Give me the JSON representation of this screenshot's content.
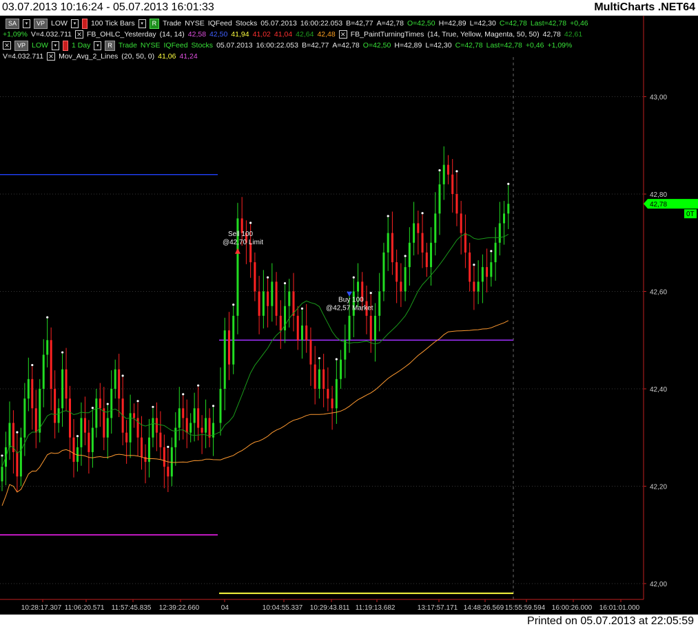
{
  "window": {
    "title": "03.07.2013 10:16:24 - 05.07.2013 16:01:33",
    "brand": "MultiCharts .NET64",
    "printed": "Printed on 05.07.2013 at 22:05:59"
  },
  "status_rows": {
    "row1": {
      "chip_sa": "SA",
      "chip_vp": "VP",
      "low": "LOW",
      "bars": "100 Tick Bars",
      "chip_r": "R",
      "trade": "Trade",
      "exchange": "NYSE",
      "feed": "IQFeed",
      "type": "Stocks",
      "date": "05.07.2013",
      "time": "16:00:22.053",
      "bid": "B=42,77",
      "ask": "A=42,78",
      "open": "O=42,50",
      "high": "H=42,89",
      "low_v": "L=42,30",
      "close": "C=42,78",
      "last": "Last=42,78",
      "chg": "+0,46"
    },
    "row2": {
      "pct": "+1,09%",
      "vol": "V=4.032.711",
      "ind1": "FB_OHLC_Yesterday",
      "ind1_params": "(14, 14)",
      "v1": "42,58",
      "v2": "42,50",
      "v3": "41,94",
      "v4": "41,02",
      "v5": "41,04",
      "v6": "42,64",
      "v7": "42,48",
      "ind2": "FB_PaintTurningTimes",
      "ind2_params": "(14, True, Yellow, Magenta, 50, 50)",
      "v8": "42,78",
      "v9": "42,61"
    },
    "row3": {
      "chip_vp": "VP",
      "low": "LOW",
      "bars": "1 Day",
      "chip_r": "R",
      "trade": "Trade",
      "exchange": "NYSE",
      "feed": "IQFeed",
      "type": "Stocks",
      "date": "05.07.2013",
      "time": "16:00:22.053",
      "bid": "B=42,77",
      "ask": "A=42,78",
      "open": "O=42,50",
      "high": "H=42,89",
      "low_v": "L=42,30",
      "close": "C=42,78",
      "last": "Last=42,78",
      "chg": "+0,46",
      "pct": "+1,09%"
    },
    "row4": {
      "vol": "V=4.032.711",
      "ind": "Mov_Avg_2_Lines",
      "params": "(20, 50, 0)",
      "v1": "41,06",
      "v2": "41,24"
    }
  },
  "chart_data": {
    "type": "candlestick",
    "ylim": [
      41.95,
      43.05
    ],
    "y_ticks": [
      "43,00",
      "42,80",
      "42,60",
      "42,40",
      "42,20",
      "42,00"
    ],
    "y_tick_values": [
      43.0,
      42.8,
      42.6,
      42.4,
      42.2,
      42.0
    ],
    "x_tick_labels": [
      "10:28:17.307",
      "11:06:20.571",
      "11:57:45.835",
      "12:39:22.660",
      "04",
      "10:04:55.337",
      "10:29:43.811",
      "11:19:13.682",
      "13:17:57.171",
      "14:48:26.569",
      "15:55:59.594",
      "16:00:26.000",
      "16:01:01.000"
    ],
    "last_price": "42,78",
    "last_price_value": 42.78,
    "bar_tag": "0T",
    "trade_sell": {
      "label": "Sell 100",
      "price_label": "@42,70 Limit",
      "price": 42.7
    },
    "trade_buy": {
      "label": "Buy 100",
      "price_label": "@42,57 Market",
      "price": 42.57
    },
    "levels": [
      {
        "name": "yesterday-high",
        "value": 42.84,
        "color": "#2040ff"
      },
      {
        "name": "yesterday-low",
        "value": 42.1,
        "color": "#ff20ff"
      },
      {
        "name": "today-open",
        "value": 42.5,
        "color": "#a030ff"
      },
      {
        "name": "today-low",
        "value": 41.98,
        "color": "#ffff40"
      }
    ],
    "colors": {
      "up": "#22dd22",
      "down": "#ff2222",
      "ma_fast": "#1a9a1a",
      "ma_slow": "#ff9a30",
      "axis": "#c02020",
      "last_price_bg": "#00ff00"
    },
    "closes": [
      42.24,
      42.28,
      42.33,
      42.27,
      42.22,
      42.3,
      42.38,
      42.42,
      42.36,
      42.31,
      42.4,
      42.47,
      42.5,
      42.4,
      42.33,
      42.36,
      42.44,
      42.38,
      42.3,
      42.25,
      42.28,
      42.34,
      42.31,
      42.27,
      42.32,
      42.38,
      42.36,
      42.3,
      42.34,
      42.4,
      42.44,
      42.38,
      42.31,
      42.29,
      42.35,
      42.34,
      42.3,
      42.26,
      42.25,
      42.3,
      42.34,
      42.31,
      42.28,
      42.24,
      42.22,
      42.28,
      42.32,
      42.36,
      42.34,
      42.31,
      42.33,
      42.36,
      42.32,
      42.31,
      42.34,
      42.3,
      42.33,
      42.4,
      42.52,
      42.45,
      42.55,
      42.75,
      42.72,
      42.7,
      42.66,
      42.6,
      42.55,
      42.6,
      42.57,
      42.62,
      42.55,
      42.52,
      42.57,
      42.6,
      42.55,
      42.5,
      42.53,
      42.5,
      42.45,
      42.4,
      42.44,
      42.4,
      42.38,
      42.36,
      42.42,
      42.46,
      42.5,
      42.55,
      42.6,
      42.62,
      42.58,
      42.55,
      42.5,
      42.55,
      42.6,
      42.68,
      42.72,
      42.66,
      42.62,
      42.6,
      42.65,
      42.7,
      42.74,
      42.72,
      42.68,
      42.65,
      42.7,
      42.76,
      42.82,
      42.86,
      42.84,
      42.8,
      42.76,
      42.72,
      42.68,
      42.62,
      42.6,
      42.62,
      42.65,
      42.63,
      42.66,
      42.7,
      42.74,
      42.76,
      42.78
    ]
  }
}
